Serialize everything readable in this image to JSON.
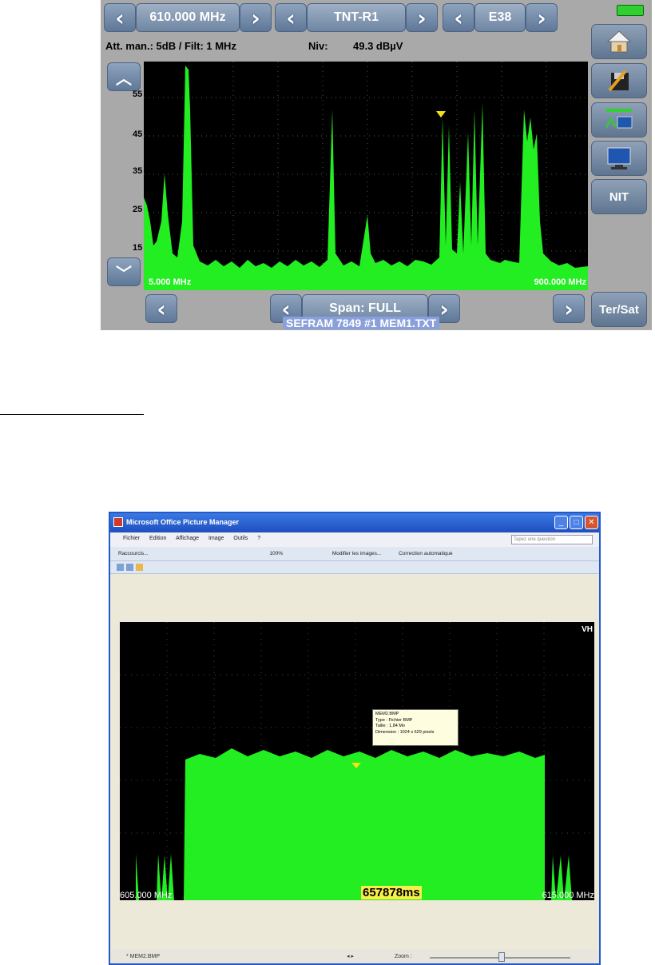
{
  "analyzer": {
    "frequency": "610.000 MHz",
    "channel_plan": "TNT-R1",
    "channel": "E38",
    "attenuation_info": "Att. man.:  5dB / Filt: 1 MHz",
    "level_label": "Niv:",
    "level_value": "49.3 dBµV",
    "y_ticks": [
      "55",
      "45",
      "35",
      "25",
      "15"
    ],
    "x_start": "5.000 MHz",
    "x_end": "900.000 MHz",
    "span": "Span: FULL",
    "file_overlay": "SEFRAM 7849 #1 MEM1.TXT",
    "side_buttons": {
      "nit": "NIT",
      "ter_sat": "Ter/Sat"
    },
    "colors": {
      "trace": "#22ee22",
      "marker": "#f2e21a",
      "panel": "#a9a9a9"
    },
    "icons": [
      "chevron-left-icon",
      "chevron-right-icon",
      "chevron-up-icon",
      "chevron-down-icon",
      "battery-icon",
      "home-icon",
      "edit-save-icon",
      "spectrum-tv-icon",
      "tv-icon"
    ]
  },
  "picture_manager": {
    "title": "Microsoft Office Picture Manager",
    "menu": [
      "Fichier",
      "Edition",
      "Affichage",
      "Image",
      "Outils",
      "?"
    ],
    "help_placeholder": "Tapez une question",
    "toolbar": {
      "shortcuts": "Raccourcis...",
      "zoom": "100%",
      "edit_images": "Modifier les images...",
      "auto_correct": "Correction automatique"
    },
    "canvas": {
      "corner_label": "VH",
      "x_start": "605.000 MHz",
      "x_end": "615.000 MHz",
      "timer": "657878ms"
    },
    "tooltip": [
      "MEM2.BMP",
      "Type : Fichier BMP",
      "Taille : 1,84 Mo",
      "Dimension : 1024 x 629 pixels"
    ],
    "status": {
      "file": "* MEM2.BMP",
      "zoom_label": "Zoom :"
    }
  }
}
